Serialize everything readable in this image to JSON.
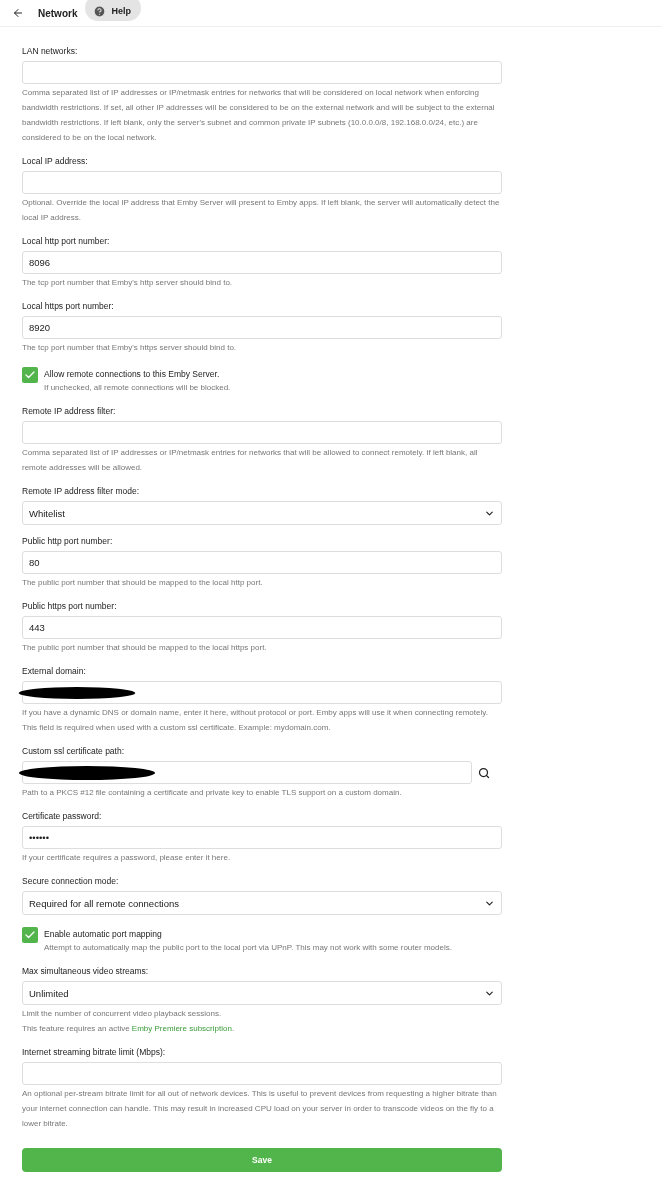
{
  "header": {
    "title": "Network",
    "help_button": "Help"
  },
  "fields": [
    {
      "kind": "text",
      "label": "LAN networks:",
      "help": "Comma separated list of IP addresses or IP/netmask entries for networks that will be considered on local network when enforcing bandwidth restrictions. If set, all other IP addresses will be considered to be on the external network and will be subject to the external bandwidth restrictions. If left blank, only the server's subnet and common private IP subnets (10.0.0.0/8, 192.168.0.0/24, etc.) are considered to be on the local network."
    },
    {
      "kind": "text",
      "label": "Local IP address:",
      "help": "Optional. Override the local IP address that Emby Server will present to Emby apps. If left blank, the server will automatically detect the local IP address."
    },
    {
      "kind": "text",
      "label": "Local http port number:",
      "value": "8096",
      "help": "The tcp port number that Emby's http server should bind to."
    },
    {
      "kind": "text",
      "label": "Local https port number:",
      "value": "8920",
      "help": "The tcp port number that Emby's https server should bind to."
    },
    {
      "kind": "checkbox",
      "label": "Allow remote connections to this Emby Server.",
      "checked": true,
      "help": "If unchecked, all remote connections will be blocked."
    },
    {
      "kind": "text",
      "label": "Remote IP address filter:",
      "help": "Comma separated list of IP addresses or IP/netmask entries for networks that will be allowed to connect remotely. If left blank, all remote addresses will be allowed."
    },
    {
      "kind": "select",
      "label": "Remote IP address filter mode:",
      "value": "Whitelist"
    },
    {
      "kind": "text",
      "label": "Public http port number:",
      "value": "80",
      "help": "The public port number that should be mapped to the local http port."
    },
    {
      "kind": "text",
      "label": "Public https port number:",
      "value": "443",
      "help": "The public port number that should be mapped to the local https port."
    },
    {
      "kind": "text",
      "label": "External domain:",
      "redacted": true,
      "help": "If you have a dynamic DNS or domain name, enter it here, without protocol or port. Emby apps will use it when connecting remotely. This field is required when used with a custom ssl certificate. Example: mydomain.com."
    },
    {
      "kind": "path",
      "label": "Custom ssl certificate path:",
      "redacted": true,
      "help": "Path to a PKCS #12 file containing a certificate and private key to enable TLS support on a custom domain."
    },
    {
      "kind": "text",
      "label": "Certificate password:",
      "value": "••••••",
      "help": "If your certificate requires a password, please enter it here."
    },
    {
      "kind": "select",
      "label": "Secure connection mode:",
      "value": "Required for all remote connections"
    },
    {
      "kind": "checkbox",
      "label": "Enable automatic port mapping",
      "checked": true,
      "help": "Attempt to automatically map the public port to the local port via UPnP. This may not work with some router models."
    },
    {
      "kind": "select",
      "label": "Max simultaneous video streams:",
      "value": "Unlimited",
      "help": "Limit the number of concurrent video playback sessions.",
      "note": {
        "text": "This feature requires an active ",
        "link": "Emby Premiere subscription",
        "suffix": "."
      }
    },
    {
      "kind": "text",
      "label": "Internet streaming bitrate limit (Mbps):",
      "help": "An optional per-stream bitrate limit for all out of network devices. This is useful to prevent devices from requesting a higher bitrate than your internet connection can handle. This may result in increased CPU load on your server in order to transcode videos on the fly to a lower bitrate."
    }
  ],
  "save_button": "Save"
}
